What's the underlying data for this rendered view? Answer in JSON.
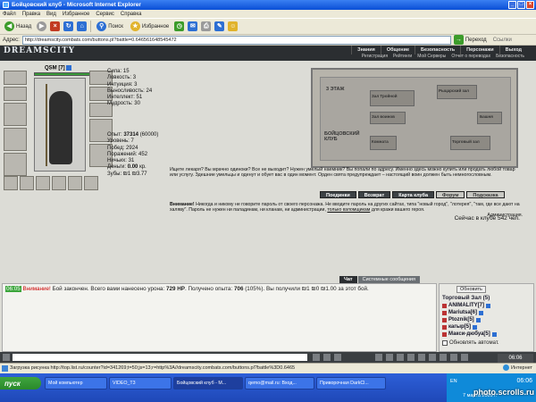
{
  "window": {
    "title": "Бойцовский клуб - Microsoft Internet Explorer"
  },
  "menu": [
    "Файл",
    "Правка",
    "Вид",
    "Избранное",
    "Сервис",
    "Справка"
  ],
  "toolbar": {
    "back": "Назад",
    "search": "Поиск",
    "favorites": "Избранное"
  },
  "address": {
    "label": "Адрес:",
    "url": "http://dreamscity.combats.com/buttons.pl?battle=0.646561648545472",
    "go": "Переход",
    "links": "Ссылки"
  },
  "site": {
    "logo": "DREAMSCITY",
    "topnav": [
      "Знания",
      "Общение",
      "Безопасность",
      "Персонажи",
      "Выход"
    ],
    "subnav": [
      "Регистрация",
      "Рейтинги",
      "Мой Серверы",
      "Отчет о переводах",
      "Безопасность"
    ]
  },
  "character": {
    "name": "QSM",
    "level": "[7]",
    "stats": [
      "Сила: 15",
      "Ловкость: 3",
      "Интуиция: 3",
      "Выносливость: 24",
      "Интеллект: 51",
      "Мудрость: 30"
    ],
    "exp_label": "Опыт:",
    "exp_value": "37314",
    "exp_next": "(60000)",
    "level_line": "Уровень: 7",
    "wins": "Побед: 2924",
    "losses": "Поражений: 452",
    "draws": "Ничьих: 31",
    "money_label": "Деньги:",
    "money_value": "0.00",
    "money_unit": "кр.",
    "teeth": "Зубы: ₪1 ₪3.77"
  },
  "map": {
    "title": "3 ЭТАЖ",
    "club": "БОЙЦОВСКИЙ КЛУБ",
    "rooms": [
      "Зал Тройной",
      "Рыцарский зал",
      "Зал воинов",
      "Башня",
      "Комната",
      "Торговый зал",
      "Бойцовский клуб"
    ]
  },
  "info": {
    "text": "Ищете лекаря? Вы мрачно одиноки? Все не выходит? Нужен умелый наемник? Вы попали по адресу. Именно здесь можно купить или продать любой товар или услугу. Здешние умельцы и оденут и обует вас в один момент. Орден свята предупреждает – настоящий воин должен быть немногословным."
  },
  "buttons": [
    "Поединки",
    "Возврат",
    "Карта клуба",
    "Форум",
    "Подсказка"
  ],
  "warning": {
    "head": "Внимание!",
    "text": "Никогда и никому не говорите пароль от своего персонажа. Не вводите пароль на других сайтах, типа \"новый город\", \"лотерея\", \"там, где все дают на халяву\". Пароль не нужен ни паладинам, ни кланам, ни администрации,",
    "link": "только взломщикам",
    "tail": "для кражи вашего героя.",
    "sign": "Администрация."
  },
  "online": "Сейчас в клубе 542 чел.",
  "chat": {
    "tabs": [
      "Чат",
      "Системные сообщения"
    ],
    "time": "06:05",
    "label": "Внимание!",
    "message_a": "Бой закончен. Всего вами нанесено урона:",
    "damage": "729 HP",
    "message_b": ". Получено опыта:",
    "exp": "706",
    "message_c": "(105%). Вы получили ₪1 ₪0 ₪1.00 за этот бой."
  },
  "room": {
    "refresh": "Обновить",
    "title": "Торговый Зал (5)",
    "players": [
      "ANIMALITY[7]",
      "Mariutsa[6]",
      "Ptoznik[5]",
      "кагыр[5]",
      "Макси-дюбуа[5]"
    ],
    "auto_refresh": "Обновлять автомат."
  },
  "status": {
    "text": "Загрузка рисунка http://top.list.ru/counter?id=341269;t=50;js=13;r=http%3A//dreamscity.combats.com/buttons.pl?battle%3D0.6465",
    "zone": "Интернет"
  },
  "clock_overlay": "06:06",
  "taskbar": {
    "start": "пуск",
    "tasks": [
      "Мой компьютер",
      "VIDEO_T3",
      "Бойцовский клуб - М...",
      "qemo@mail.ru: Вход...",
      "Приворочная DarkCl..."
    ],
    "lang": "EN",
    "time": "06:06",
    "date": "7 марта 2009 г."
  },
  "watermark": "photo.scrolls.ru",
  "colors": {
    "accent": "#2b2e31",
    "hp": "#3a9a3a"
  }
}
